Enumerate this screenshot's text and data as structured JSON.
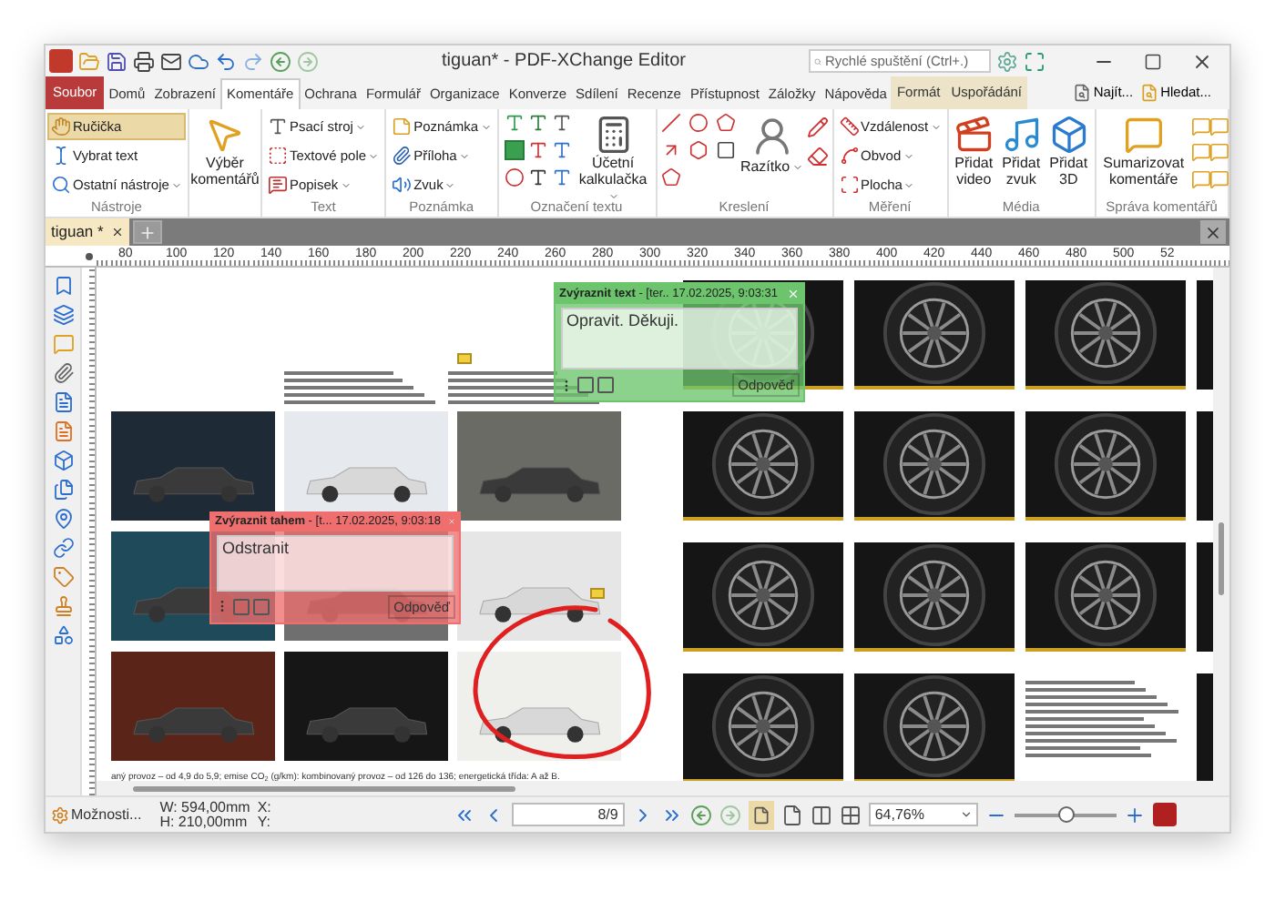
{
  "window": {
    "title": "tiguan* - PDF-XChange Editor",
    "search": {
      "placeholder": "Rychlé spuštění (Ctrl+.)"
    }
  },
  "menu_tabs": [
    {
      "label": "Soubor",
      "kind": "file",
      "selected": false
    },
    {
      "label": "Domů",
      "kind": "tab",
      "selected": false
    },
    {
      "label": "Zobrazení",
      "kind": "tab",
      "selected": false
    },
    {
      "label": "Komentáře",
      "kind": "tab",
      "selected": true
    },
    {
      "label": "Ochrana",
      "kind": "tab",
      "selected": false
    },
    {
      "label": "Formulář",
      "kind": "tab",
      "selected": false
    },
    {
      "label": "Organizace",
      "kind": "tab",
      "selected": false
    },
    {
      "label": "Konverze",
      "kind": "tab",
      "selected": false
    },
    {
      "label": "Sdílení",
      "kind": "tab",
      "selected": false
    },
    {
      "label": "Recenze",
      "kind": "tab",
      "selected": false
    },
    {
      "label": "Přístupnost",
      "kind": "tab",
      "selected": false
    },
    {
      "label": "Záložky",
      "kind": "tab",
      "selected": false
    },
    {
      "label": "Nápověda",
      "kind": "tab",
      "selected": false
    },
    {
      "label": "Formát",
      "kind": "context",
      "selected": false
    },
    {
      "label": "Uspořádání",
      "kind": "context",
      "selected": false
    }
  ],
  "menu_right": [
    "Najít...",
    "Hledat..."
  ],
  "ribbon": [
    {
      "label": "Nástroje",
      "kind": "list",
      "items": [
        {
          "label": "Ručička",
          "selected": true,
          "dropdown": false
        },
        {
          "label": "Vybrat text",
          "selected": false,
          "dropdown": false
        },
        {
          "label": "Ostatní nástroje",
          "selected": false,
          "dropdown": true
        }
      ]
    },
    {
      "kind": "large",
      "items": [
        {
          "label": "Výběr komentářů",
          "selected": false,
          "dropdown": false
        }
      ]
    },
    {
      "label": "Text",
      "kind": "list",
      "items": [
        {
          "label": "Psací stroj",
          "selected": false,
          "dropdown": true
        },
        {
          "label": "Textové pole",
          "selected": false,
          "dropdown": true
        },
        {
          "label": "Popisek",
          "selected": false,
          "dropdown": true
        }
      ]
    },
    {
      "label": "Poznámka",
      "kind": "list",
      "items": [
        {
          "label": "Poznámka",
          "selected": false,
          "dropdown": true
        },
        {
          "label": "Příloha",
          "selected": false,
          "dropdown": true
        },
        {
          "label": "Zvuk",
          "selected": false,
          "dropdown": true
        }
      ]
    },
    {
      "label": "Označení textu",
      "kind": "markup",
      "items": [
        {
          "label": "Účetní kalkulačka",
          "selected": false,
          "dropdown": true
        }
      ]
    },
    {
      "label": "Kreslení",
      "kind": "drawing",
      "items": [
        {
          "label": "Razítko",
          "selected": false,
          "dropdown": true
        }
      ]
    },
    {
      "label": "Měření",
      "kind": "list",
      "items": [
        {
          "label": "Vzdálenost",
          "selected": false,
          "dropdown": true
        },
        {
          "label": "Obvod",
          "selected": false,
          "dropdown": true
        },
        {
          "label": "Plocha",
          "selected": false,
          "dropdown": true
        }
      ]
    },
    {
      "label": "Média",
      "kind": "large",
      "items": [
        {
          "label": "Přidat video",
          "selected": false,
          "dropdown": false
        },
        {
          "label": "Přidat zvuk",
          "selected": false,
          "dropdown": false
        },
        {
          "label": "Přidat 3D",
          "selected": false,
          "dropdown": false
        }
      ]
    },
    {
      "label": "Správa komentářů",
      "kind": "manage",
      "items": [
        {
          "label": "Sumarizovat komentáře",
          "selected": false,
          "dropdown": false
        }
      ]
    }
  ],
  "doc_tabs": [
    {
      "label": "tiguan *",
      "selected": true
    }
  ],
  "ruler": [
    "80",
    "100",
    "120",
    "140",
    "160",
    "180",
    "200",
    "220",
    "240",
    "260",
    "280",
    "300",
    "320",
    "340",
    "360",
    "380",
    "400",
    "420",
    "440",
    "460",
    "480",
    "500",
    "52"
  ],
  "document": {
    "caption": "aný provoz – od 4,9 do 5,9; emise CO$_{2}$ (g/km): kombinovaný provoz – od 126 do 136; energetická třída: A až B.",
    "notes": [
      {
        "title": "Zvýraznit text",
        "meta": " - [ter.. 17.02.2025, 9:03:31",
        "text": "Opravit. Děkuji.",
        "reply": "Odpověď",
        "color": "#6cc46c"
      },
      {
        "title": "Zvýraznit tahem",
        "meta": " - [t... 17.02.2025, 9:03:18",
        "text": "Odstranit",
        "reply": "Odpověď",
        "color": "#ef6f6f"
      }
    ]
  },
  "status_bar": {
    "options": "Možnosti...",
    "width": "W: 594,00mm",
    "height": "H: 210,00mm",
    "x": "X:",
    "y": "Y:",
    "page": "8/9",
    "zoom": "64,76%",
    "zoom_slider": {
      "level": 0.5
    }
  }
}
